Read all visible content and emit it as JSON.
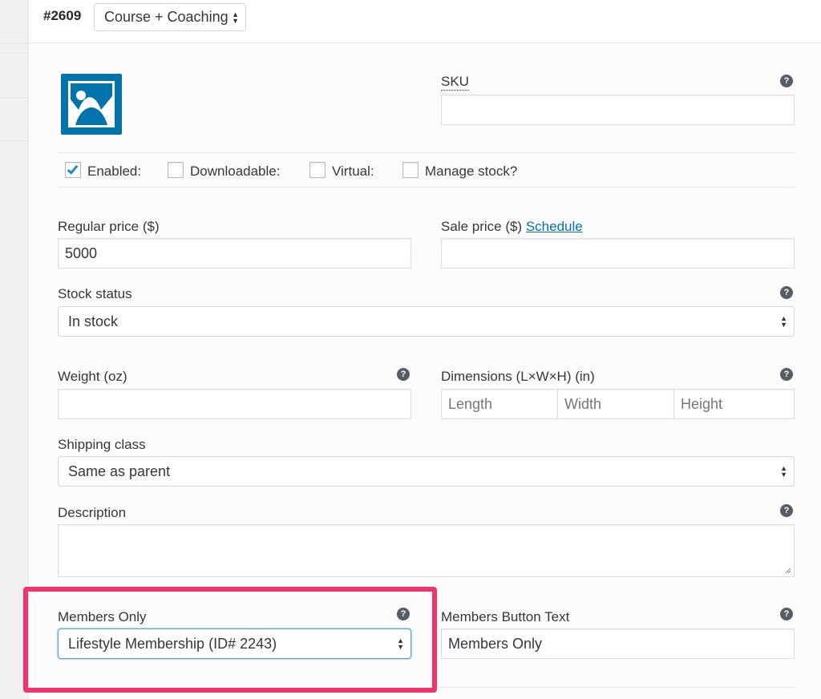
{
  "variation": {
    "id_label": "#2609",
    "type_select": "Course + Coaching"
  },
  "icons": {
    "help": "question-mark-circle-icon",
    "select_arrows": "up-down-arrows-icon",
    "thumbnail": "image-placeholder-icon"
  },
  "sku": {
    "label": "SKU",
    "value": ""
  },
  "options": {
    "enabled": {
      "label": "Enabled:",
      "checked": true
    },
    "downloadable": {
      "label": "Downloadable:",
      "checked": false
    },
    "virtual": {
      "label": "Virtual:",
      "checked": false
    },
    "manage_stock": {
      "label": "Manage stock?",
      "checked": false
    }
  },
  "pricing": {
    "regular_label": "Regular price ($)",
    "regular_value": "5000",
    "sale_label": "Sale price ($)",
    "schedule_link": "Schedule",
    "sale_value": ""
  },
  "stock": {
    "label": "Stock status",
    "value": "In stock"
  },
  "weight": {
    "label": "Weight (oz)",
    "value": ""
  },
  "dimensions": {
    "label": "Dimensions (L×W×H) (in)",
    "length_placeholder": "Length",
    "width_placeholder": "Width",
    "height_placeholder": "Height"
  },
  "shipping": {
    "label": "Shipping class",
    "value": "Same as parent"
  },
  "description": {
    "label": "Description",
    "value": ""
  },
  "members": {
    "only_label": "Members Only",
    "only_value": "Lifestyle Membership (ID# 2243)",
    "button_text_label": "Members Button Text",
    "button_text_value": "Members Only"
  },
  "colors": {
    "accent": "#0073aa",
    "checkbox_tick": "#1e8cbe",
    "highlight": "#f0356b"
  }
}
